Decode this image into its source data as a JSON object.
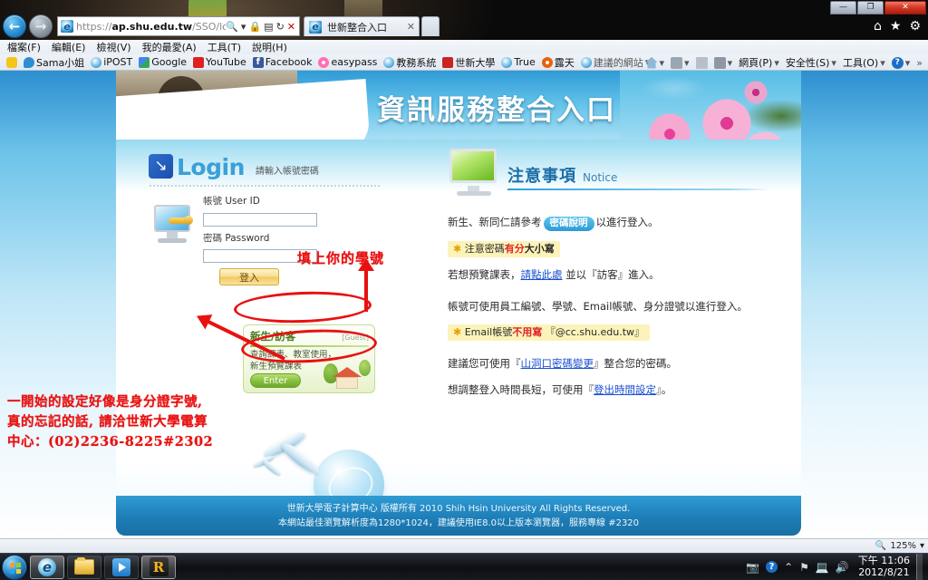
{
  "window": {
    "minimize_label": "—",
    "maximize_label": "❐",
    "close_label": "✕"
  },
  "browser": {
    "back_label": "←",
    "forward_label": "→",
    "address_url_protocol": "https://",
    "address_url_host": "ap.shu.edu.tw",
    "address_url_path": "/SSO/login.aspx?",
    "address_placeholder": "",
    "search_icon": "search-icon",
    "dropdown_icon": "▾",
    "lock_icon": "🔒",
    "compat_icon": "▤",
    "refresh_icon": "↻",
    "stop_icon": "✕",
    "tab_title": "世新整合入口",
    "tab_close": "✕",
    "home_icon": "⌂",
    "favorites_icon": "★",
    "tools_icon": "⚙",
    "menus": [
      "檔案(F)",
      "編輯(E)",
      "檢視(V)",
      "我的最愛(A)",
      "工具(T)",
      "說明(H)"
    ],
    "favorites": [
      {
        "label": "",
        "icon": "star-icon",
        "color": "#f5c518"
      },
      {
        "label": "Sama小姐",
        "icon": "chat-icon",
        "color": "#2f8ed0"
      },
      {
        "label": "iPOST",
        "icon": "ie-icon",
        "color": "#7fc4e8"
      },
      {
        "label": "Google",
        "icon": "google-icon",
        "color": "#4285f4"
      },
      {
        "label": "YouTube",
        "icon": "youtube-icon",
        "color": "#e02020"
      },
      {
        "label": "Facebook",
        "icon": "facebook-icon",
        "color": "#3b5998"
      },
      {
        "label": "easypass",
        "icon": "easypass-icon",
        "color": "#ff6fb5"
      },
      {
        "label": "教務系統",
        "icon": "ie-icon",
        "color": "#7fc4e8"
      },
      {
        "label": "世新大學",
        "icon": "shu-icon",
        "color": "#cc2222"
      },
      {
        "label": "True",
        "icon": "ie-icon",
        "color": "#7fc4e8"
      },
      {
        "label": "露天",
        "icon": "ruten-icon",
        "color": "#e8620e"
      },
      {
        "label": "建議的網站",
        "icon": "ie-icon",
        "color": "#7fc4e8"
      }
    ],
    "favorites_overflow": "»",
    "commands": [
      {
        "label": "",
        "icon": "home-icon"
      },
      {
        "label": "",
        "icon": "feed-icon"
      },
      {
        "label": "",
        "icon": "mail-icon"
      },
      {
        "label": "",
        "icon": "print-icon"
      },
      {
        "label": "網頁(P)",
        "icon": "page-icon"
      },
      {
        "label": "安全性(S)",
        "icon": "safety-icon"
      },
      {
        "label": "工具(O)",
        "icon": "tools-icon"
      },
      {
        "label": "",
        "icon": "help-icon"
      }
    ],
    "commands_overflow": "»"
  },
  "page": {
    "header_title": "資訊服務整合入口",
    "login": {
      "word": "Login",
      "mark_icon": "login-arrow-icon",
      "subtitle": "請輸入帳號密碼",
      "userid_label_cjk": "帳號",
      "userid_label_en": "User ID",
      "userid_value": "",
      "password_label_cjk": "密碼",
      "password_label_en": "Password",
      "password_value": "",
      "submit_label": "登入"
    },
    "guest": {
      "title": "新生/訪客",
      "tag": "[Guest]",
      "line1": "查詢課表、教室使用，",
      "line2": "新生預覽課表",
      "enter_label": "Enter"
    },
    "notice": {
      "title_cjk": "注意事項",
      "title_en": "Notice",
      "line1_a": "新生、新同仁請參考",
      "line1_pill": "密碼說明",
      "line1_b": "以進行登入。",
      "hl1_star": "✱",
      "hl1_a": "注意密碼",
      "hl1_red": "有分",
      "hl1_b": "大小寫",
      "line2_a": "若想預覽課表，",
      "line2_link": "請點此處",
      "line2_b": "並以『訪客』進入。",
      "line3": "帳號可使用員工編號、學號、Email帳號、身分證號以進行登入。",
      "hl2_star": "✱",
      "hl2_a": "Email帳號",
      "hl2_red": "不用寫",
      "hl2_b": "『@cc.shu.edu.tw』",
      "line4_a": "建議您可使用『",
      "line4_link": "山洞口密碼變更",
      "line4_b": "』整合您的密碼。",
      "line5_a": "想調整登入時間長短，可使用『",
      "line5_link": "登出時間設定",
      "line5_b": "』。"
    },
    "footer_line1": "世新大學電子計算中心 版權所有 2010 Shih Hsin University All Rights Reserved.",
    "footer_line2": "本網站最佳瀏覽解析度為1280*1024，建議使用IE8.0以上版本瀏覽器，服務專線 #2320"
  },
  "annotations": {
    "note_fill_student_id": "填上你的學號",
    "note_body_line1": "一開始的設定好像是身分證字號,",
    "note_body_line2": "真的忘記的話, 請洽世新大學電算",
    "note_body_line3": "中心：(02)2236-8225#2302",
    "ink_color": "#e8110f"
  },
  "statusbar": {
    "zoom_icon": "zoom-icon",
    "zoom_level": "125%",
    "zoom_caret": "▾"
  },
  "taskbar": {
    "start_label": "",
    "items": [
      {
        "name": "internet-explorer",
        "label": ""
      },
      {
        "name": "file-explorer",
        "label": ""
      },
      {
        "name": "media-player",
        "label": ""
      },
      {
        "name": "r-app",
        "label": "R"
      }
    ],
    "tray_icons": [
      "camera-icon",
      "help-icon",
      "chevron-up-icon",
      "flag-icon",
      "network-icon",
      "volume-icon"
    ],
    "time": "下午 11:06",
    "date": "2012/8/21"
  }
}
